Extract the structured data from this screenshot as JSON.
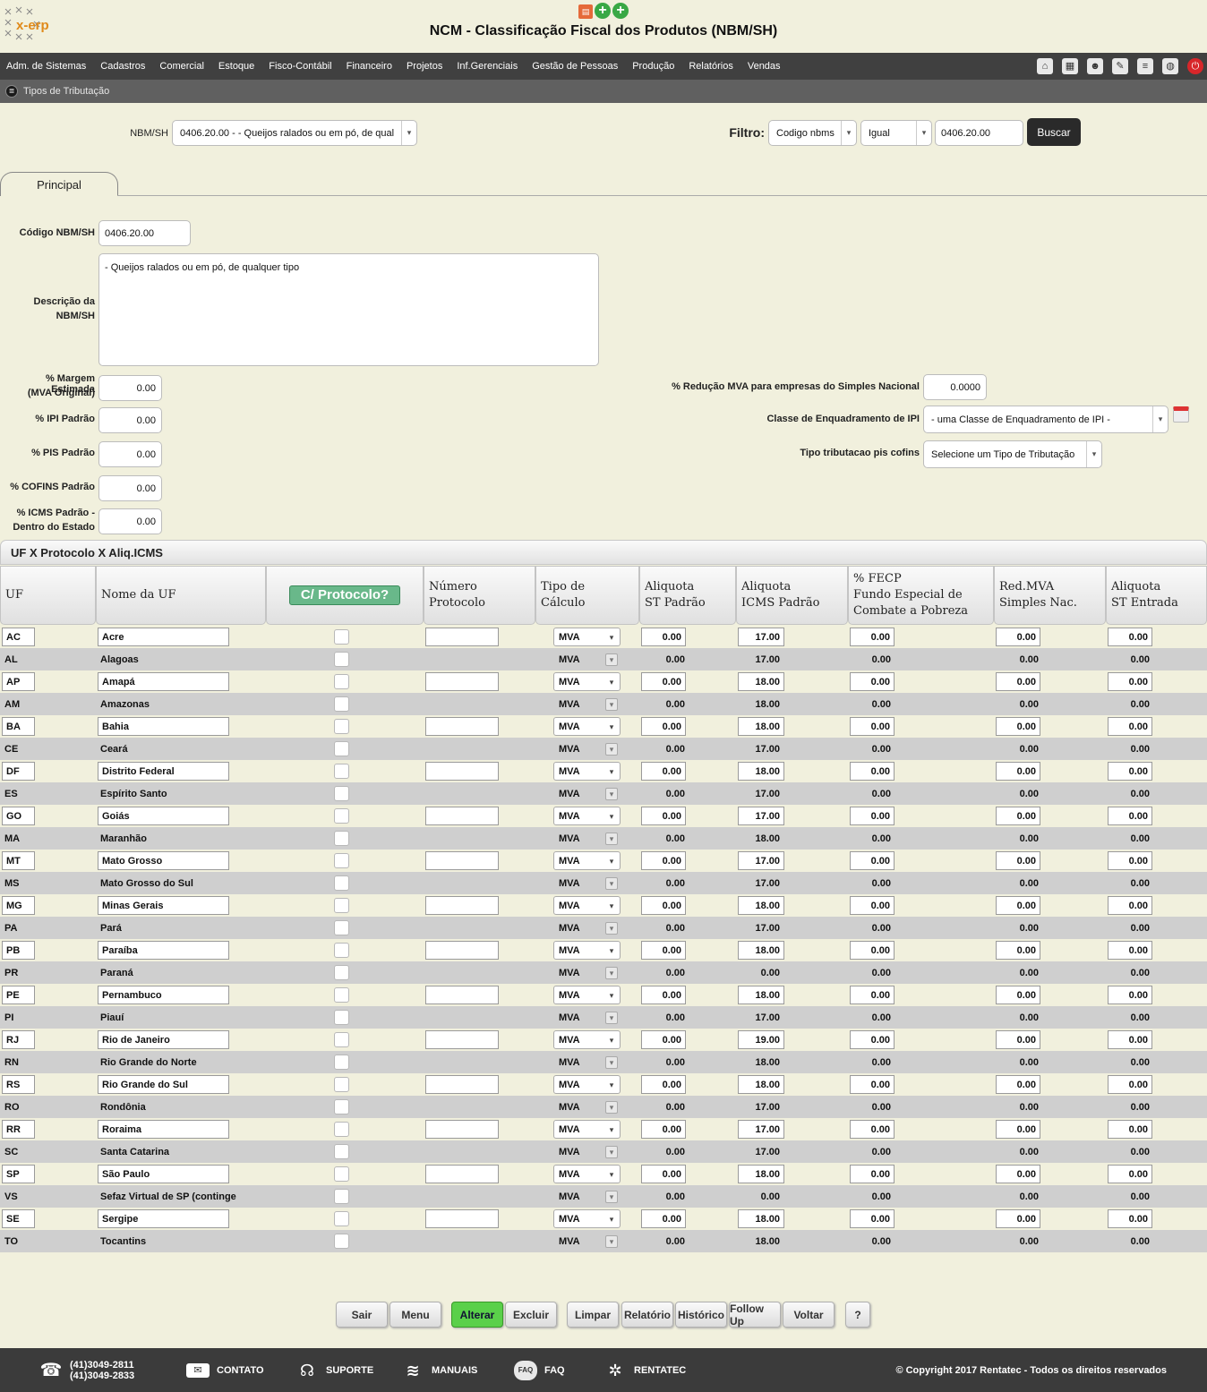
{
  "header": {
    "logo_text": "x-erp",
    "title": "NCM - Classificação Fiscal dos Produtos (NBM/SH)"
  },
  "menu": {
    "items": [
      "Adm. de Sistemas",
      "Cadastros",
      "Comercial",
      "Estoque",
      "Fisco-Contábil",
      "Financeiro",
      "Projetos",
      "Inf.Gerenciais",
      "Gestão de Pessoas",
      "Produção",
      "Relatórios",
      "Vendas"
    ]
  },
  "subbar": {
    "label": "Tipos de Tributação"
  },
  "filter": {
    "nbm_label": "NBM/SH",
    "nbm_value": "0406.20.00 - - Queijos ralados ou em pó, de qual",
    "filtro_label": "Filtro:",
    "field": "Codigo nbms",
    "operator": "Igual",
    "value": "0406.20.00",
    "search_button": "Buscar"
  },
  "tab": {
    "label": "Principal"
  },
  "form": {
    "codigo_label": "Código NBM/SH",
    "codigo_value": "0406.20.00",
    "descricao_label_1": "Descrição da",
    "descricao_label_2": "NBM/SH",
    "descricao_value": "- Queijos ralados ou em pó, de qualquer tipo",
    "margem_label_1": "% Margem Estimada",
    "margem_label_2": "(MVA Original)",
    "margem_value": "0.00",
    "ipi_label": "% IPI Padrão",
    "ipi_value": "0.00",
    "pis_label": "% PIS Padrão",
    "pis_value": "0.00",
    "cofins_label": "% COFINS Padrão",
    "cofins_value": "0.00",
    "icms_label_1": "% ICMS Padrão -",
    "icms_label_2": "Dentro do Estado",
    "icms_value": "0.00",
    "reducao_label": "% Redução MVA para empresas do Simples Nacional",
    "reducao_value": "0.0000",
    "classe_label": "Classe de Enquadramento de IPI",
    "classe_value": "- uma Classe de Enquadramento de IPI -",
    "tipo_label": "Tipo tributacao pis cofins",
    "tipo_value": "Selecione um Tipo de Tributação"
  },
  "section": {
    "title": "UF X Protocolo X Aliq.ICMS"
  },
  "grid": {
    "headers": {
      "uf": "UF",
      "nome": "Nome da UF",
      "protocolo_button": "C/ Protocolo?",
      "numero_1": "Número",
      "numero_2": "Protocolo",
      "tipo_1": "Tipo de",
      "tipo_2": "Cálculo",
      "st_1": "Aliquota",
      "st_2": "ST Padrão",
      "icms_1": "Aliquota",
      "icms_2": "ICMS Padrão",
      "fecp_1": "% FECP",
      "fecp_2": "Fundo Especial de",
      "fecp_3": "Combate a Pobreza",
      "red_1": "Red.MVA",
      "red_2": "Simples Nac.",
      "entrada_1": "Aliquota",
      "entrada_2": "ST Entrada"
    },
    "rows": [
      {
        "uf": "AC",
        "nome": "Acre",
        "tipo": "MVA",
        "st": "0.00",
        "icms": "17.00",
        "fecp": "0.00",
        "red": "0.00",
        "entrada": "0.00"
      },
      {
        "uf": "AL",
        "nome": "Alagoas",
        "tipo": "MVA",
        "st": "0.00",
        "icms": "17.00",
        "fecp": "0.00",
        "red": "0.00",
        "entrada": "0.00"
      },
      {
        "uf": "AP",
        "nome": "Amapá",
        "tipo": "MVA",
        "st": "0.00",
        "icms": "18.00",
        "fecp": "0.00",
        "red": "0.00",
        "entrada": "0.00"
      },
      {
        "uf": "AM",
        "nome": "Amazonas",
        "tipo": "MVA",
        "st": "0.00",
        "icms": "18.00",
        "fecp": "0.00",
        "red": "0.00",
        "entrada": "0.00"
      },
      {
        "uf": "BA",
        "nome": "Bahia",
        "tipo": "MVA",
        "st": "0.00",
        "icms": "18.00",
        "fecp": "0.00",
        "red": "0.00",
        "entrada": "0.00"
      },
      {
        "uf": "CE",
        "nome": "Ceará",
        "tipo": "MVA",
        "st": "0.00",
        "icms": "17.00",
        "fecp": "0.00",
        "red": "0.00",
        "entrada": "0.00"
      },
      {
        "uf": "DF",
        "nome": "Distrito Federal",
        "tipo": "MVA",
        "st": "0.00",
        "icms": "18.00",
        "fecp": "0.00",
        "red": "0.00",
        "entrada": "0.00"
      },
      {
        "uf": "ES",
        "nome": "Espírito Santo",
        "tipo": "MVA",
        "st": "0.00",
        "icms": "17.00",
        "fecp": "0.00",
        "red": "0.00",
        "entrada": "0.00"
      },
      {
        "uf": "GO",
        "nome": "Goiás",
        "tipo": "MVA",
        "st": "0.00",
        "icms": "17.00",
        "fecp": "0.00",
        "red": "0.00",
        "entrada": "0.00"
      },
      {
        "uf": "MA",
        "nome": "Maranhão",
        "tipo": "MVA",
        "st": "0.00",
        "icms": "18.00",
        "fecp": "0.00",
        "red": "0.00",
        "entrada": "0.00"
      },
      {
        "uf": "MT",
        "nome": "Mato Grosso",
        "tipo": "MVA",
        "st": "0.00",
        "icms": "17.00",
        "fecp": "0.00",
        "red": "0.00",
        "entrada": "0.00"
      },
      {
        "uf": "MS",
        "nome": "Mato Grosso do Sul",
        "tipo": "MVA",
        "st": "0.00",
        "icms": "17.00",
        "fecp": "0.00",
        "red": "0.00",
        "entrada": "0.00"
      },
      {
        "uf": "MG",
        "nome": "Minas Gerais",
        "tipo": "MVA",
        "st": "0.00",
        "icms": "18.00",
        "fecp": "0.00",
        "red": "0.00",
        "entrada": "0.00"
      },
      {
        "uf": "PA",
        "nome": "Pará",
        "tipo": "MVA",
        "st": "0.00",
        "icms": "17.00",
        "fecp": "0.00",
        "red": "0.00",
        "entrada": "0.00"
      },
      {
        "uf": "PB",
        "nome": "Paraíba",
        "tipo": "MVA",
        "st": "0.00",
        "icms": "18.00",
        "fecp": "0.00",
        "red": "0.00",
        "entrada": "0.00"
      },
      {
        "uf": "PR",
        "nome": "Paraná",
        "tipo": "MVA",
        "st": "0.00",
        "icms": "0.00",
        "fecp": "0.00",
        "red": "0.00",
        "entrada": "0.00"
      },
      {
        "uf": "PE",
        "nome": "Pernambuco",
        "tipo": "MVA",
        "st": "0.00",
        "icms": "18.00",
        "fecp": "0.00",
        "red": "0.00",
        "entrada": "0.00"
      },
      {
        "uf": "PI",
        "nome": "Piauí",
        "tipo": "MVA",
        "st": "0.00",
        "icms": "17.00",
        "fecp": "0.00",
        "red": "0.00",
        "entrada": "0.00"
      },
      {
        "uf": "RJ",
        "nome": "Rio de Janeiro",
        "tipo": "MVA",
        "st": "0.00",
        "icms": "19.00",
        "fecp": "0.00",
        "red": "0.00",
        "entrada": "0.00"
      },
      {
        "uf": "RN",
        "nome": "Rio Grande do Norte",
        "tipo": "MVA",
        "st": "0.00",
        "icms": "18.00",
        "fecp": "0.00",
        "red": "0.00",
        "entrada": "0.00"
      },
      {
        "uf": "RS",
        "nome": "Rio Grande do Sul",
        "tipo": "MVA",
        "st": "0.00",
        "icms": "18.00",
        "fecp": "0.00",
        "red": "0.00",
        "entrada": "0.00"
      },
      {
        "uf": "RO",
        "nome": "Rondônia",
        "tipo": "MVA",
        "st": "0.00",
        "icms": "17.00",
        "fecp": "0.00",
        "red": "0.00",
        "entrada": "0.00"
      },
      {
        "uf": "RR",
        "nome": "Roraima",
        "tipo": "MVA",
        "st": "0.00",
        "icms": "17.00",
        "fecp": "0.00",
        "red": "0.00",
        "entrada": "0.00"
      },
      {
        "uf": "SC",
        "nome": "Santa Catarina",
        "tipo": "MVA",
        "st": "0.00",
        "icms": "17.00",
        "fecp": "0.00",
        "red": "0.00",
        "entrada": "0.00"
      },
      {
        "uf": "SP",
        "nome": "São Paulo",
        "tipo": "MVA",
        "st": "0.00",
        "icms": "18.00",
        "fecp": "0.00",
        "red": "0.00",
        "entrada": "0.00"
      },
      {
        "uf": "VS",
        "nome": "Sefaz Virtual de SP (continge",
        "tipo": "MVA",
        "st": "0.00",
        "icms": "0.00",
        "fecp": "0.00",
        "red": "0.00",
        "entrada": "0.00"
      },
      {
        "uf": "SE",
        "nome": "Sergipe",
        "tipo": "MVA",
        "st": "0.00",
        "icms": "18.00",
        "fecp": "0.00",
        "red": "0.00",
        "entrada": "0.00"
      },
      {
        "uf": "TO",
        "nome": "Tocantins",
        "tipo": "MVA",
        "st": "0.00",
        "icms": "18.00",
        "fecp": "0.00",
        "red": "0.00",
        "entrada": "0.00"
      }
    ]
  },
  "buttons": {
    "sair": "Sair",
    "menu": "Menu",
    "alterar": "Alterar",
    "excluir": "Excluir",
    "limpar": "Limpar",
    "relatorio": "Relatório",
    "historico": "Histórico",
    "followup": "Follow Up",
    "voltar": "Voltar",
    "help": "?"
  },
  "footer": {
    "phone_1": "(41)3049-2811",
    "phone_2": "(41)3049-2833",
    "contato": "CONTATO",
    "suporte": "SUPORTE",
    "manuais": "MANUAIS",
    "faq": "FAQ",
    "faq_icon_text": "FAQ",
    "rentatec": "RENTATEC",
    "copyright": "© Copyright 2017 Rentatec - Todos os direitos reservados"
  },
  "colors": {
    "background": "#f1f0dd",
    "menubar": "#404040",
    "alterar_button": "#5ad04a",
    "protocolo_button": "#69b88a"
  }
}
